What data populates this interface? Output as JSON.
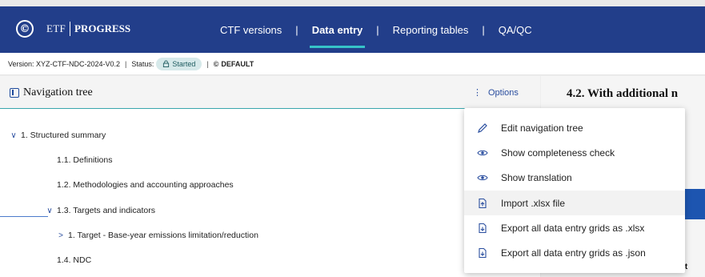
{
  "app": {
    "logo_symbol": "©",
    "brand_left": "ETF",
    "brand_right": "PROGRESS"
  },
  "nav": {
    "items": [
      {
        "label": "CTF versions",
        "active": false
      },
      {
        "label": "Data entry",
        "active": true
      },
      {
        "label": "Reporting tables",
        "active": false
      },
      {
        "label": "QA/QC",
        "active": false
      }
    ],
    "divider": "|"
  },
  "status": {
    "version_text": "Version: XYZ-CTF-NDC-2024-V0.2",
    "separator": "|",
    "status_label": "Status:",
    "status_badge": "Started",
    "default_label": "DEFAULT",
    "default_symbol": "©"
  },
  "left_panel": {
    "title": "Navigation tree",
    "options_label": "Options",
    "options_symbol": "⋮",
    "tree": [
      {
        "label": "1. Structured summary",
        "chevron": "∨"
      },
      {
        "label": "1.1. Definitions",
        "chevron": ""
      },
      {
        "label": "1.2. Methodologies and accounting approaches",
        "chevron": ""
      },
      {
        "label": "1.3. Targets and indicators",
        "chevron": "∨"
      },
      {
        "label": "1. Target - Base-year emissions limitation/reduction",
        "chevron": ">"
      },
      {
        "label": "1.4. NDC",
        "chevron": ""
      }
    ]
  },
  "right_panel": {
    "title": "4.2. With additional n",
    "partial_text": "rt"
  },
  "menu": {
    "items": [
      {
        "label": "Edit navigation tree",
        "icon": "pencil-icon",
        "symbol": "✎"
      },
      {
        "label": "Show completeness check",
        "icon": "eye-icon",
        "symbol": "◉"
      },
      {
        "label": "Show translation",
        "icon": "eye-icon",
        "symbol": "◉"
      },
      {
        "label": "Import .xlsx file",
        "icon": "file-upload-icon",
        "symbol": "⇧"
      },
      {
        "label": "Export all data entry grids as .xlsx",
        "icon": "file-download-icon",
        "symbol": "⇩"
      },
      {
        "label": "Export all data entry grids as .json",
        "icon": "file-download-icon",
        "symbol": "⇩"
      }
    ]
  },
  "colors": {
    "topbar": "#223e8a",
    "accent_teal": "#36c3c8",
    "link_blue": "#2a4e9f"
  }
}
